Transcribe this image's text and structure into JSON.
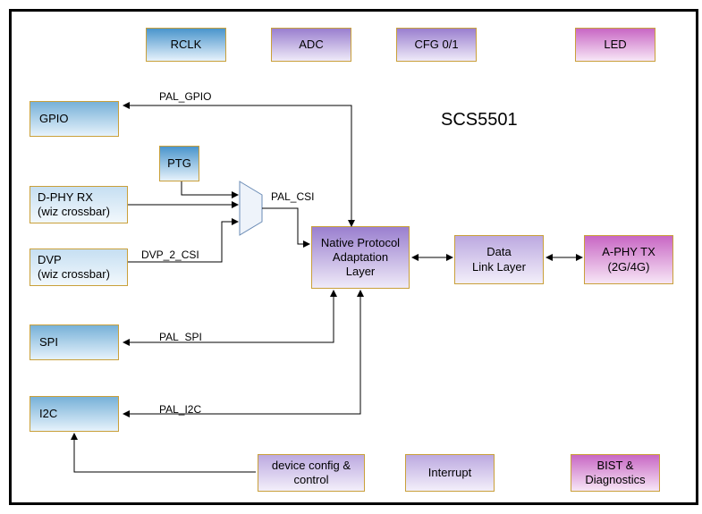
{
  "title": "SCS5501",
  "top": {
    "rclk": "RCLK",
    "adc": "ADC",
    "cfg": "CFG 0/1",
    "led": "LED"
  },
  "left": {
    "gpio": "GPIO",
    "ptg": "PTG",
    "dphy": "D-PHY RX\n(wiz crossbar)",
    "dvp": "DVP\n(wiz crossbar)",
    "spi": "SPI",
    "i2c": "I2C"
  },
  "center": {
    "npal": "Native Protocol\nAdaptation\nLayer",
    "dll": "Data\nLink Layer",
    "aphy": "A-PHY TX\n(2G/4G)"
  },
  "bottom": {
    "devcfg": "device config &\ncontrol",
    "interrupt": "Interrupt",
    "bist": "BIST &\nDiagnostics"
  },
  "labels": {
    "pal_gpio": "PAL_GPIO",
    "pal_csi": "PAL_CSI",
    "dvp2csi": "DVP_2_CSI",
    "pal_spi": "PAL_SPI",
    "pal_i2c": "PAL_I2C"
  },
  "chart_data": {
    "type": "block-diagram",
    "title": "SCS5501",
    "nodes": [
      {
        "id": "rclk",
        "label": "RCLK",
        "group": "clock"
      },
      {
        "id": "adc",
        "label": "ADC",
        "group": "mixed"
      },
      {
        "id": "cfg",
        "label": "CFG 0/1",
        "group": "mixed"
      },
      {
        "id": "led",
        "label": "LED",
        "group": "aphy"
      },
      {
        "id": "gpio",
        "label": "GPIO",
        "group": "io"
      },
      {
        "id": "ptg",
        "label": "PTG",
        "group": "io"
      },
      {
        "id": "dphy",
        "label": "D-PHY RX (wiz crossbar)",
        "group": "io"
      },
      {
        "id": "dvp",
        "label": "DVP (wiz crossbar)",
        "group": "io"
      },
      {
        "id": "spi",
        "label": "SPI",
        "group": "io"
      },
      {
        "id": "i2c",
        "label": "I2C",
        "group": "io"
      },
      {
        "id": "mux",
        "label": "(mux)",
        "group": "logic"
      },
      {
        "id": "npal",
        "label": "Native Protocol Adaptation Layer",
        "group": "core"
      },
      {
        "id": "dll",
        "label": "Data Link Layer",
        "group": "core"
      },
      {
        "id": "aphy",
        "label": "A-PHY TX (2G/4G)",
        "group": "aphy"
      },
      {
        "id": "devcfg",
        "label": "device config & control",
        "group": "core"
      },
      {
        "id": "interrupt",
        "label": "Interrupt",
        "group": "core"
      },
      {
        "id": "bist",
        "label": "BIST & Diagnostics",
        "group": "aphy"
      }
    ],
    "edges": [
      {
        "from": "npal",
        "to": "gpio",
        "label": "PAL_GPIO",
        "dir": "both"
      },
      {
        "from": "ptg",
        "to": "mux",
        "dir": "fwd"
      },
      {
        "from": "dphy",
        "to": "mux",
        "dir": "fwd"
      },
      {
        "from": "dvp",
        "to": "mux",
        "label": "DVP_2_CSI",
        "dir": "fwd"
      },
      {
        "from": "mux",
        "to": "npal",
        "label": "PAL_CSI",
        "dir": "fwd"
      },
      {
        "from": "npal",
        "to": "spi",
        "label": "PAL_SPI",
        "dir": "both"
      },
      {
        "from": "npal",
        "to": "i2c",
        "label": "PAL_I2C",
        "dir": "both"
      },
      {
        "from": "npal",
        "to": "dll",
        "dir": "both"
      },
      {
        "from": "dll",
        "to": "aphy",
        "dir": "both"
      },
      {
        "from": "devcfg",
        "to": "i2c",
        "dir": "fwd"
      }
    ]
  }
}
